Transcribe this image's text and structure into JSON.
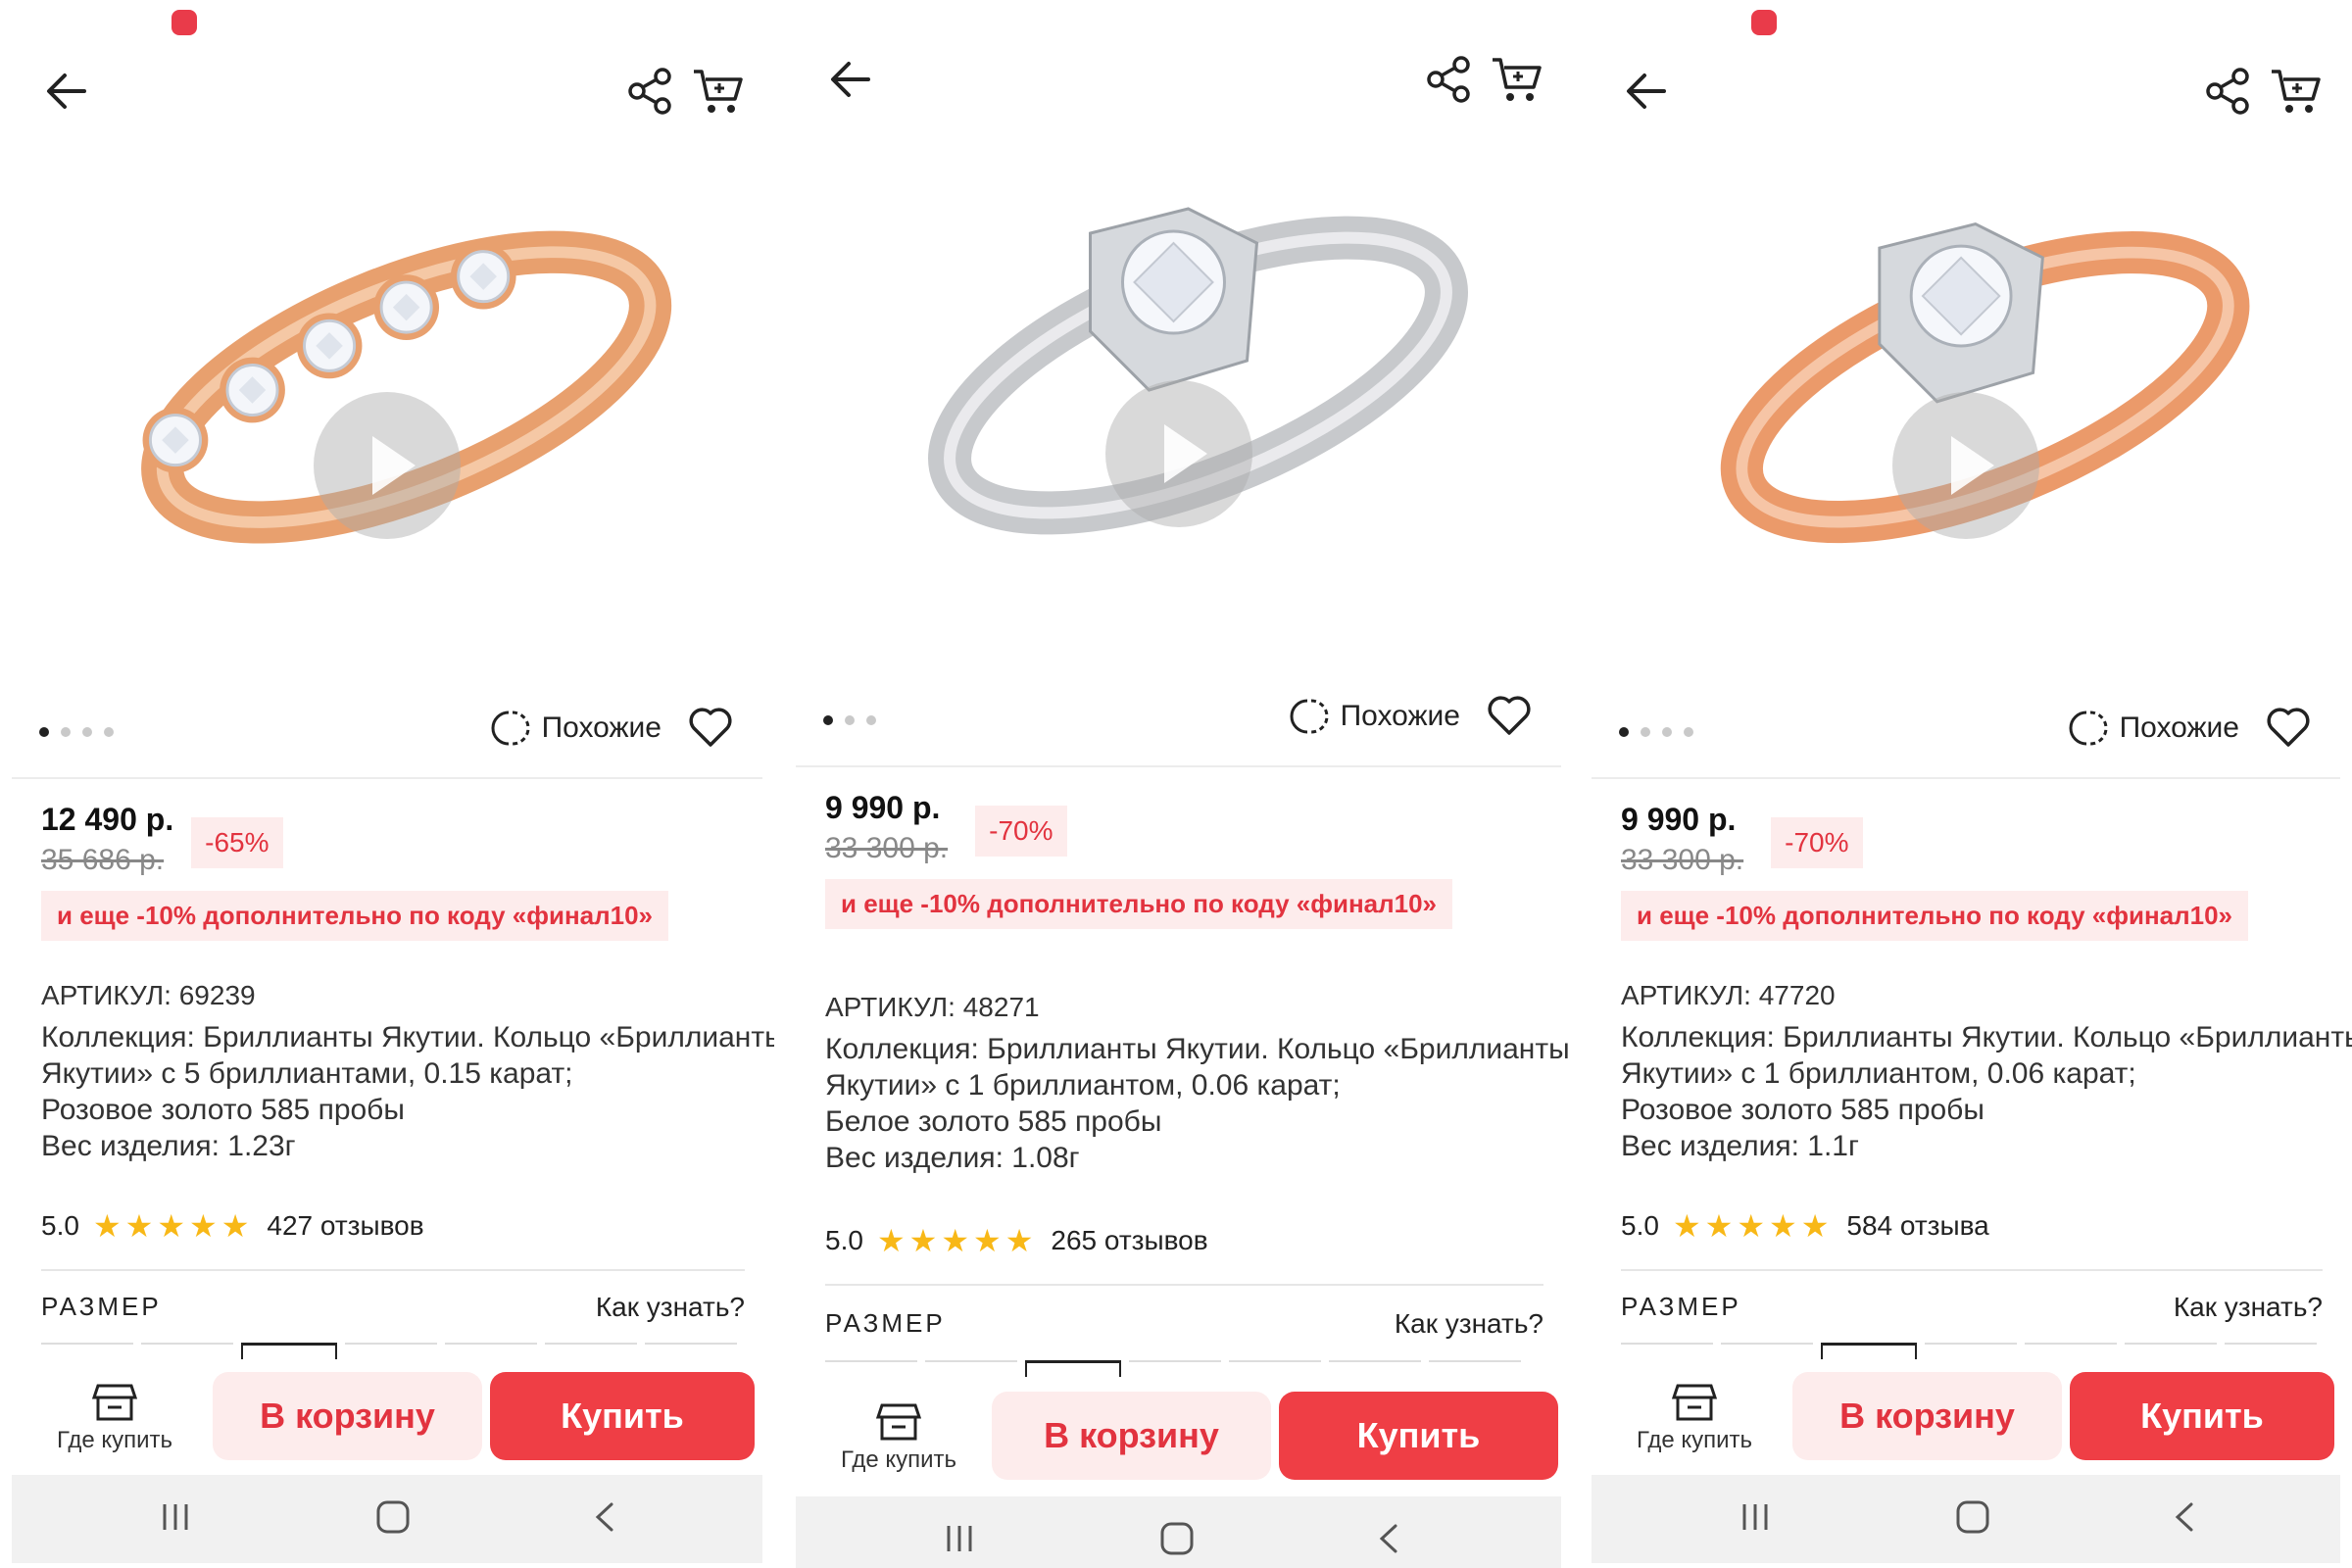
{
  "panels": [
    {
      "similar_label": "Похожие",
      "price": "12 490 р.",
      "old_price": "35 686 р.",
      "discount": "-65%",
      "promo": "и еще -10% дополнительно по коду «финал10»",
      "article": "АРТИКУЛ: 69239",
      "description": [
        "Коллекция: Бриллианты Якутии. Кольцо «Бриллианты",
        "Якутии» с 5 бриллиантами, 0.15 карат;",
        "Розовое золото 585 пробы",
        "Вес изделия: 1.23г"
      ],
      "rating": "5.0",
      "stars": 5,
      "reviews": "427 отзывов",
      "size_label": "РАЗМЕР",
      "size_help": "Как узнать?",
      "where_label": "Где купить",
      "to_cart_label": "В корзину",
      "buy_label": "Купить",
      "image_dots": 4,
      "active_dot": 0,
      "metal_color": "#e8a06e",
      "metal_highlight": "#f7d2b3"
    },
    {
      "similar_label": "Похожие",
      "price": "9 990 р.",
      "old_price": "33 300 р.",
      "discount": "-70%",
      "promo": "и еще -10% дополнительно по коду «финал10»",
      "article": "АРТИКУЛ: 48271",
      "description": [
        "Коллекция: Бриллианты Якутии. Кольцо «Бриллианты",
        "Якутии» с 1 бриллиантом, 0.06 карат;",
        "Белое золото 585 пробы",
        "Вес изделия: 1.08г"
      ],
      "rating": "5.0",
      "stars": 5,
      "reviews": "265 отзывов",
      "size_label": "РАЗМЕР",
      "size_help": "Как узнать?",
      "where_label": "Где купить",
      "to_cart_label": "В корзину",
      "buy_label": "Купить",
      "image_dots": 3,
      "active_dot": 0,
      "metal_color": "#c7c9cc",
      "metal_highlight": "#f2f3f5"
    },
    {
      "similar_label": "Похожие",
      "price": "9 990 р.",
      "old_price": "33 300 р.",
      "discount": "-70%",
      "promo": "и еще -10% дополнительно по коду «финал10»",
      "article": "АРТИКУЛ: 47720",
      "description": [
        "Коллекция: Бриллианты Якутии. Кольцо «Бриллианты",
        "Якутии» с 1 бриллиантом, 0.06 карат;",
        "Розовое золото 585 пробы",
        "Вес изделия: 1.1г"
      ],
      "rating": "5.0",
      "stars": 5,
      "reviews": "584 отзыва",
      "size_label": "РАЗМЕР",
      "size_help": "Как узнать?",
      "where_label": "Где купить",
      "to_cart_label": "В корзину",
      "buy_label": "Купить",
      "image_dots": 4,
      "active_dot": 0,
      "metal_color": "#eb9a6a",
      "metal_highlight": "#f9d0b5"
    }
  ],
  "colors": {
    "accent_red": "#ef3e45",
    "badge_bg": "#fdecec",
    "star": "#f8b817"
  },
  "icons": [
    "back-arrow-icon",
    "share-icon",
    "cart-icon",
    "similar-icon",
    "heart-icon",
    "store-icon",
    "play-icon",
    "nav-recent-icon",
    "nav-home-icon",
    "nav-back-icon"
  ]
}
